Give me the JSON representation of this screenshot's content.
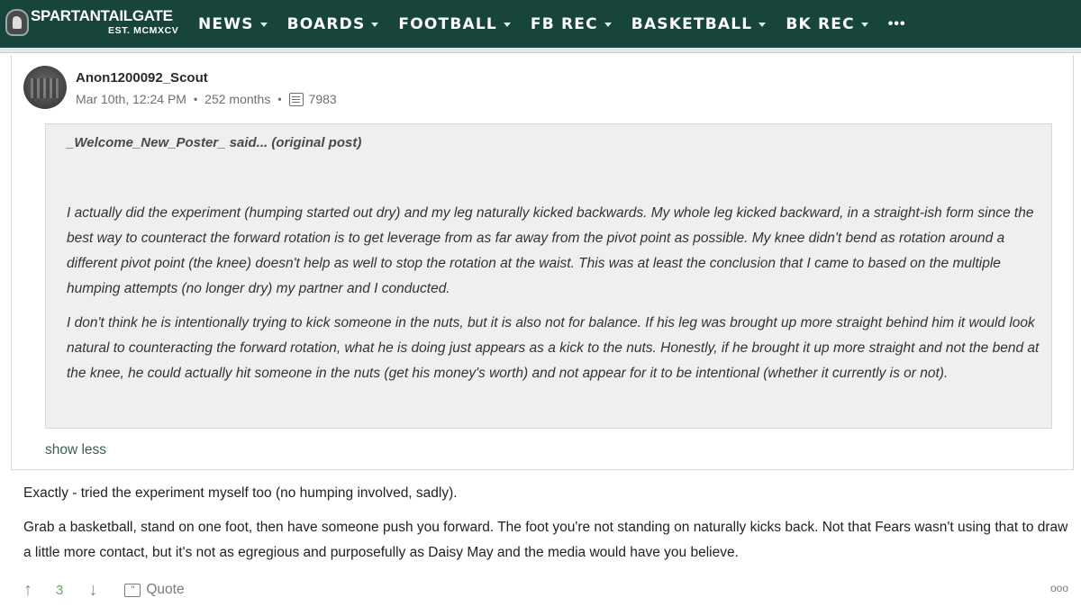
{
  "nav": {
    "logo_title": "SPARTANTAILGATE",
    "logo_sub": "EST. MCMXCV",
    "items": [
      {
        "label": "NEWS"
      },
      {
        "label": "BOARDS"
      },
      {
        "label": "FOOTBALL"
      },
      {
        "label": "FB REC"
      },
      {
        "label": "BASKETBALL"
      },
      {
        "label": "BK REC"
      }
    ],
    "more": "•••"
  },
  "post": {
    "username": "Anon1200092_Scout",
    "timestamp": "Mar 10th, 12:24 PM",
    "tenure": "252 months",
    "post_count": "7983",
    "quote": {
      "header": "_Welcome_New_Poster_ said... (original post)",
      "paragraphs": [
        "I actually did the experiment (humping started out dry) and my leg naturally kicked backwards. My whole leg kicked backward, in a straight-ish form since the best way to counteract the forward rotation is to get leverage from as far away from the pivot point as possible. My knee didn't bend as rotation around a different pivot point (the knee) doesn't help as well to stop the rotation at the waist. This was at least the conclusion that I came to based on the multiple humping attempts (no longer dry) my partner and I conducted.",
        "I don't think he is intentionally trying to kick someone in the nuts, but it is also not for balance. If his leg was brought up more straight behind him it would look natural to counteracting the forward rotation, what he is doing just appears as a kick to the nuts. Honestly, if he brought it up more straight and not the bend at the knee, he could actually hit someone in the nuts (get his money's worth) and not appear for it to be intentional (whether it currently is or not)."
      ]
    },
    "show_less": "show less",
    "body": [
      "Exactly - tried the experiment myself too (no humping involved, sadly).",
      "Grab a basketball, stand on one foot, then have someone push you forward. The foot you're not standing on naturally kicks back. Not that Fears wasn't using that to draw a little more contact, but it's not as egregious and purposefully as Daisy May and the media would have you believe."
    ],
    "actions": {
      "vote_count": "3",
      "quote_label": "Quote",
      "more_label": "ooo"
    }
  },
  "colors": {
    "nav_bg": "#18453b",
    "vote_green": "#6aa36a",
    "quote_bg": "#efefef"
  }
}
